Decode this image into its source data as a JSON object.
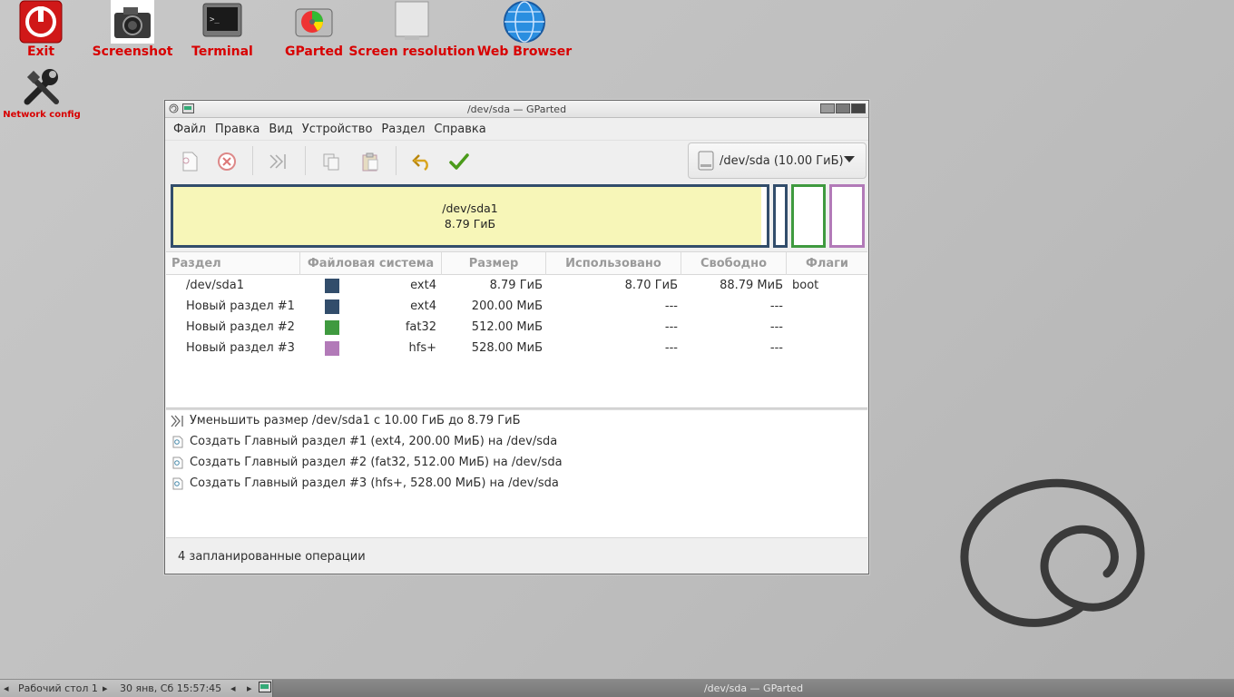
{
  "desktop": {
    "icons": [
      {
        "label": "Exit",
        "icon": "power-icon"
      },
      {
        "label": "Screenshot",
        "icon": "camera-icon"
      },
      {
        "label": "Terminal",
        "icon": "terminal-icon"
      },
      {
        "label": "GParted",
        "icon": "gparted-icon"
      },
      {
        "label": "Screen resolution",
        "icon": "monitor-icon"
      },
      {
        "label": "Web Browser",
        "icon": "globe-icon"
      },
      {
        "label": "Network config",
        "icon": "tools-icon"
      }
    ]
  },
  "window": {
    "title": "/dev/sda — GParted",
    "menu": [
      "Файл",
      "Правка",
      "Вид",
      "Устройство",
      "Раздел",
      "Справка"
    ],
    "device_selector": "/dev/sda (10.00 ГиБ)",
    "partition_map": {
      "main_name": "/dev/sda1",
      "main_size": "8.79 ГиБ"
    },
    "columns": [
      "Раздел",
      "Файловая система",
      "Размер",
      "Использовано",
      "Свободно",
      "Флаги"
    ],
    "partitions": [
      {
        "name": "/dev/sda1",
        "color": "#324d6b",
        "fs": "ext4",
        "size": "8.79 ГиБ",
        "used": "8.70 ГиБ",
        "free": "88.79 МиБ",
        "flags": "boot"
      },
      {
        "name": "Новый раздел #1",
        "color": "#324d6b",
        "fs": "ext4",
        "size": "200.00 МиБ",
        "used": "---",
        "free": "---",
        "flags": ""
      },
      {
        "name": "Новый раздел #2",
        "color": "#3f9a3f",
        "fs": "fat32",
        "size": "512.00 МиБ",
        "used": "---",
        "free": "---",
        "flags": ""
      },
      {
        "name": "Новый раздел #3",
        "color": "#b27ab8",
        "fs": "hfs+",
        "size": "528.00 МиБ",
        "used": "---",
        "free": "---",
        "flags": ""
      }
    ],
    "operations": [
      "Уменьшить размер /dev/sda1 с 10.00 ГиБ до 8.79 ГиБ",
      "Создать Главный раздел #1 (ext4, 200.00 МиБ) на /dev/sda",
      "Создать Главный раздел #2 (fat32, 512.00 МиБ) на /dev/sda",
      "Создать Главный раздел #3 (hfs+, 528.00 МиБ) на /dev/sda"
    ],
    "status": "4 запланированные операции"
  },
  "taskbar": {
    "desktop": "Рабочий стол 1",
    "clock": "30 янв, Сб 15:57:45",
    "task": "/dev/sda — GParted"
  }
}
